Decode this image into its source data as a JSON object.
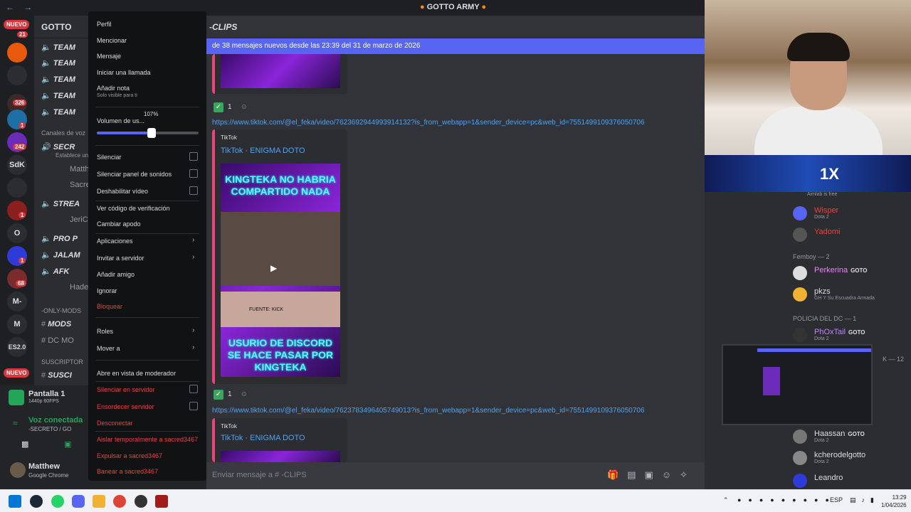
{
  "window": {
    "title": "GOTTO ARMY",
    "back_icon": "arrow-left-icon",
    "forward_icon": "arrow-right-icon"
  },
  "servers": {
    "nuevo_top": "NUEVO",
    "nuevo_bottom": "NUEVO",
    "badges": [
      "21",
      "326",
      "1",
      "242",
      "1",
      "1",
      "68"
    ],
    "labels": [
      "SdK",
      "O",
      "M-",
      "M",
      "ES2.0"
    ]
  },
  "channels": {
    "server_name": "GOTTO",
    "team_items": [
      "TEAM",
      "TEAM",
      "TEAM",
      "TEAM",
      "TEAM"
    ],
    "voice_category": "Canales de voz",
    "secreto": "SECR",
    "secreto_sub": "Establece un",
    "users": [
      "Matth",
      "Sacre"
    ],
    "stream": "STREA",
    "stream_user": "JeriCH",
    "pro": "PRO P",
    "jalam": "JALAM",
    "afk": "AFK",
    "afk_user": "Hades",
    "only_mods": "-ONLY-MODS",
    "mods": "MODS",
    "dc_mod": "DC MO",
    "suscriptor": "SUSCRIPTOR",
    "susc": "SUSCI"
  },
  "user_panel": {
    "screen_title": "Pantalla 1",
    "screen_sub": "1440p 60FPS",
    "voice_status": "Voz conectada",
    "voice_channel": "-SECRETO / GO",
    "username": "Matthew",
    "activity": "Google Chrome"
  },
  "chat": {
    "channel": "-CLIPS",
    "new_banner": "de 38 mensajes nuevos desde las 23:39 del 31 de marzo de 2026",
    "reaction_count_1": "1",
    "reaction_count_2": "1",
    "link_1": "https://www.tiktok.com/@el_feka/video/7623692944993914132?is_from_webapp=1&sender_device=pc&web_id=7551499109376050706",
    "link_2": "https://www.tiktok.com/@el_feka/video/7623783496405749013?is_from_webapp=1&sender_device=pc&web_id=7551499109376050706",
    "embed_provider": "TikTok",
    "embed_title": "TikTok · ENIGMA DOTO",
    "embed_provider_2": "TikTok",
    "embed_title_2": "TikTok · ENIGMA DOTO",
    "thumb_top_text": "KINGTEKA NO HABRIA COMPARTIDO NADA",
    "thumb_caption": "FUENTE: KICK",
    "thumb_bottom_text": "USURIO DE DISCORD SE HACE PASAR POR KINGTEKA",
    "composer_placeholder": "Enviar mensaje a # -CLIPS"
  },
  "context_menu": {
    "perfil": "Perfil",
    "mencionar": "Mencionar",
    "mensaje": "Mensaje",
    "llamada": "Iniciar una llamada",
    "nota": "Añadir nota",
    "nota_sub": "Solo visible para ti",
    "volumen": "Volumen de us...",
    "volumen_tooltip": "107%",
    "volumen_level": 0.535,
    "silenciar": "Silenciar",
    "silenciar_sonidos": "Silenciar panel de sonidos",
    "deshabilitar_video": "Deshabilitar vídeo",
    "codigo": "Ver código de verificación",
    "apodo": "Cambiar apodo",
    "aplicaciones": "Aplicaciones",
    "invitar": "Invitar a servidor",
    "amigo": "Añadir amigo",
    "ignorar": "Ignorar",
    "bloquear": "Bloquear",
    "roles": "Roles",
    "mover": "Mover a",
    "moderador": "Abre en vista de moderador",
    "silenciar_servidor": "Silenciar en servidor",
    "ensordecer": "Ensordecer servidor",
    "desconectar": "Desconectar",
    "aislar": "Aislar temporalmente a sacred3467",
    "expulsar": "Expulsar a sacred3467",
    "banear": "Banear a sacred3467"
  },
  "stream": {
    "multiplier": "1X",
    "aimlab": "Aimlab is free",
    "members": [
      {
        "name": "Wisper",
        "activity": "Dota 2",
        "color": "#f23f43"
      },
      {
        "name": "Yadomi",
        "activity": "",
        "color": "#f23f43"
      }
    ],
    "femboy_group": "Femboy — 2",
    "perkerina": "Perkerina",
    "pkzs": "pkzs",
    "pkzs_activity": "GH Y Su Escuadra Armada",
    "policia_group": "POLICIA DEL DC — 1",
    "phoxtail": "PhOxTail",
    "phoxtail_activity": "Dota 2",
    "k_group": "K — 12",
    "haassan": "Haassan",
    "haassan_activity": "Dota 2",
    "kcherodelgotto": "kcherodelgotto",
    "kcherodelgotto_activity": "Dota 2",
    "leandro": "Leandro",
    "goto_tag": "GOTO"
  },
  "taskbar": {
    "lang": "ESP",
    "time": "13:29",
    "date": "1/04/2026"
  },
  "colors": {
    "accent": "#5865f2",
    "danger": "#f23f43",
    "link": "#4ea4f5",
    "online": "#23a55a"
  }
}
